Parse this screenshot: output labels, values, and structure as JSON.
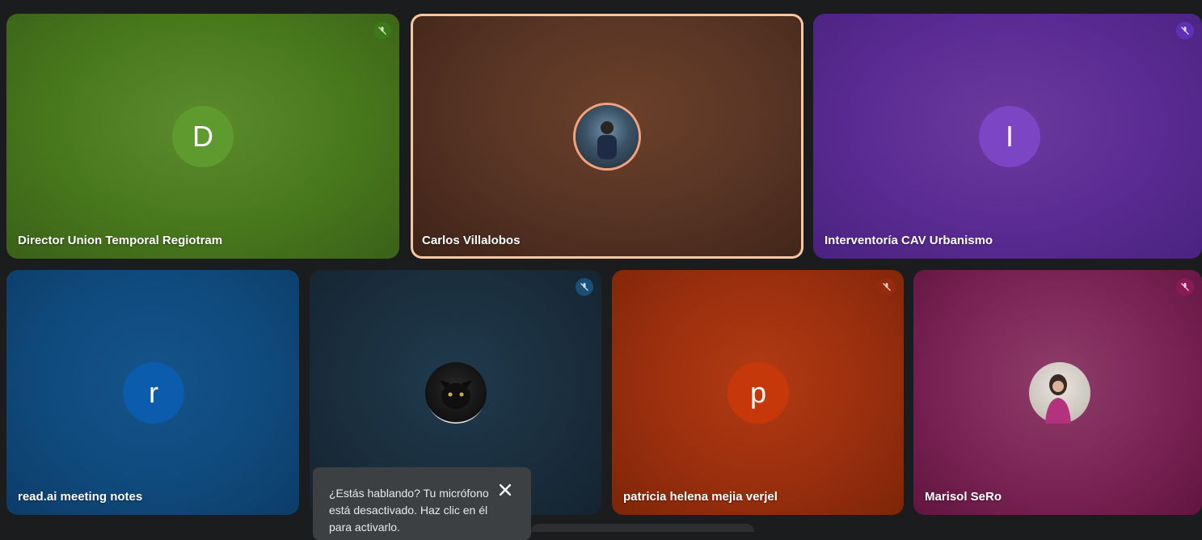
{
  "participants": [
    {
      "name": "Director Union Temporal Regiotram",
      "initial": "D",
      "avatar_color": "#5e9a2e",
      "mic_badge_color": "#3a7a1a",
      "muted": true
    },
    {
      "name": "Carlos Villalobos",
      "avatar": "photo",
      "muted": false,
      "speaking": true
    },
    {
      "name": "Interventoría CAV Urbanismo",
      "initial": "I",
      "avatar_color": "#7b45c4",
      "mic_badge_color": "#5f2fb5",
      "muted": true
    },
    {
      "name": "read.ai meeting notes",
      "initial": "r",
      "avatar_color": "#0b5cad",
      "muted": false
    },
    {
      "name": "",
      "avatar": "photo-cat",
      "mic_badge_color": "#1c4f78",
      "muted": true
    },
    {
      "name": "patricia helena mejia verjel",
      "initial": "p",
      "avatar_color": "#c6380a",
      "mic_badge_color": "#952a0c",
      "muted": true
    },
    {
      "name": "Marisol SeRo",
      "avatar": "photo",
      "mic_badge_color": "#8a1a55",
      "muted": true
    }
  ],
  "toast": {
    "message": "¿Estás hablando? Tu micrófono está desactivado. Haz clic en él para activarlo.",
    "close_icon": "close-icon"
  }
}
